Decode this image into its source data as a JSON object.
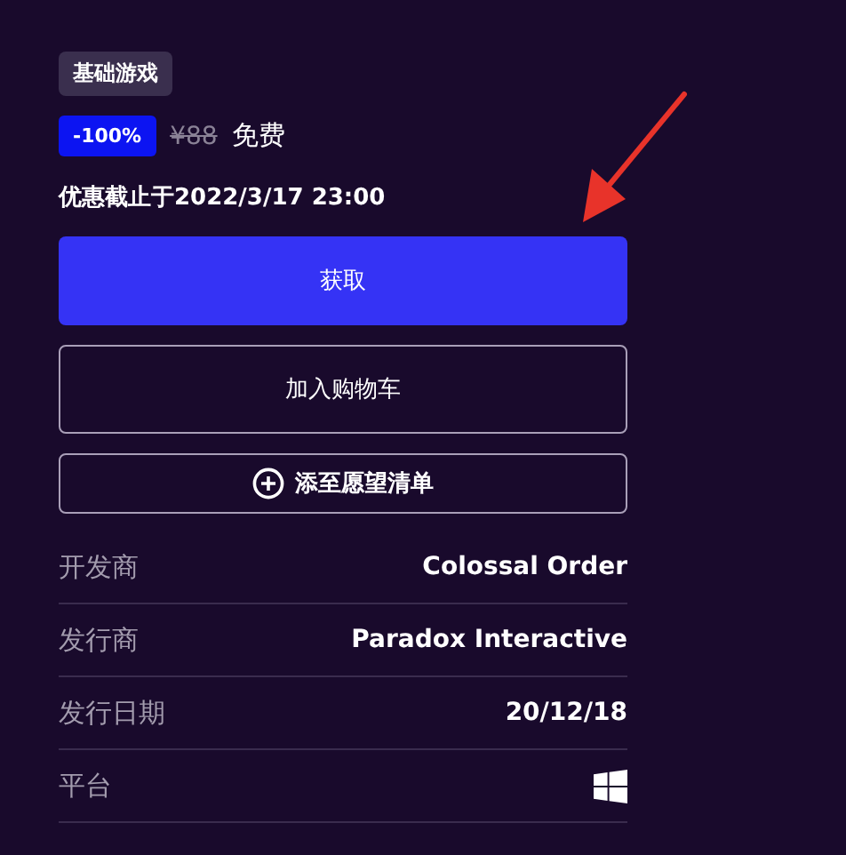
{
  "tag": "基础游戏",
  "price": {
    "discount": "-100%",
    "original": "¥88",
    "current": "免费"
  },
  "deadline": "优惠截止于2022/3/17 23:00",
  "buttons": {
    "get": "获取",
    "cart": "加入购物车",
    "wishlist": "添至愿望清单"
  },
  "details": [
    {
      "kind": "text",
      "label": "开发商",
      "value": "Colossal Order"
    },
    {
      "kind": "text",
      "label": "发行商",
      "value": "Paradox Interactive"
    },
    {
      "kind": "text",
      "label": "发行日期",
      "value": "20/12/18"
    },
    {
      "kind": "platform",
      "label": "平台"
    }
  ]
}
